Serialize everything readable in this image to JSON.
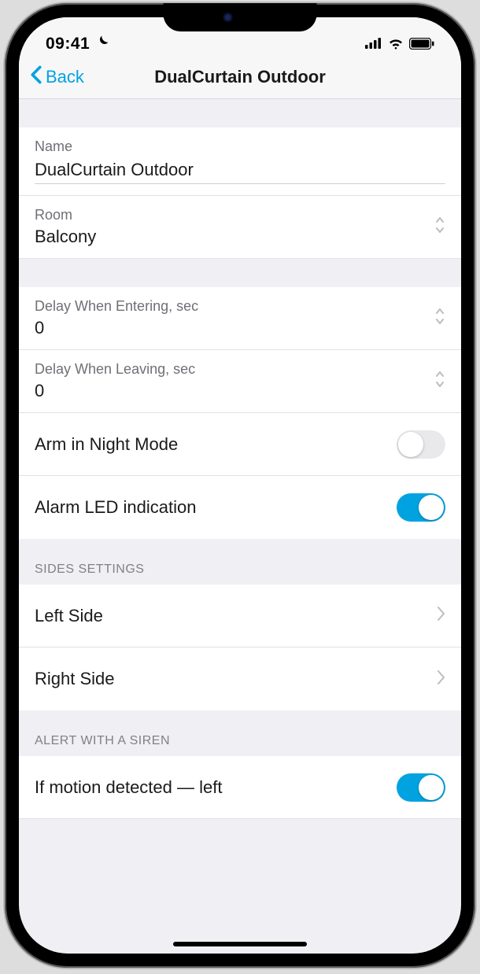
{
  "statusbar": {
    "time": "09:41"
  },
  "nav": {
    "back": "Back",
    "title": "DualCurtain Outdoor"
  },
  "fields": {
    "name_label": "Name",
    "name_value": "DualCurtain Outdoor",
    "room_label": "Room",
    "room_value": "Balcony",
    "delay_enter_label": "Delay When Entering, sec",
    "delay_enter_value": "0",
    "delay_leave_label": "Delay When Leaving, sec",
    "delay_leave_value": "0",
    "arm_night": "Arm in Night Mode",
    "alarm_led": "Alarm LED indication"
  },
  "sections": {
    "sides_header": "SIDES SETTINGS",
    "left_side": "Left Side",
    "right_side": "Right Side",
    "siren_header": "ALERT WITH A SIREN",
    "motion_left": "If motion detected — left"
  },
  "toggles": {
    "arm_night": false,
    "alarm_led": true,
    "motion_left": true
  }
}
